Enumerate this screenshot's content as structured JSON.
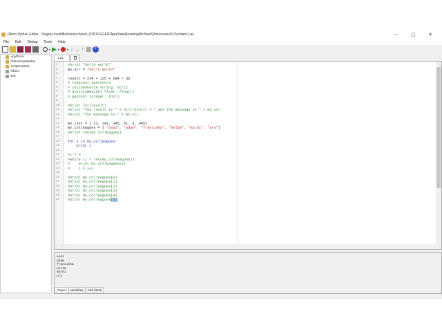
{
  "window": {
    "title": "Rhino Python Editor - \\\\tugras.local\\file\\home\\cherie\\_PROFILE\\FR\\AppData\\Roaming\\McNeel\\Rhinoceros\\6.0\\scripts\\1.py",
    "minimize": "–",
    "maximize": "▢",
    "close": "✕"
  },
  "menu": [
    "File",
    "Edit",
    "Debug",
    "Tools",
    "Help"
  ],
  "sidebar": [
    "<python>",
    "rhinoscriptsyntax",
    "scriptcontext",
    "Rhino",
    "Eto"
  ],
  "tabs": [
    {
      "label": "1.py"
    },
    {
      "label": ""
    }
  ],
  "code": [
    {
      "n": "1",
      "t": "#print \"hello world\"",
      "k": "cm"
    },
    {
      "n": "2",
      "t": "my_str = ",
      "s": "\"hello world\""
    },
    {
      "n": "3",
      "t": ""
    },
    {
      "n": "4",
      "t": "result = 234 + 125 + 284 / 36"
    },
    {
      "n": "5",
      "t": "# typecast operators",
      "k": "cm"
    },
    {
      "n": "6",
      "t": "# zeichenkette string: str()",
      "k": "cm"
    },
    {
      "n": "7",
      "t": "# gleitkommazahl float: float()",
      "k": "cm"
    },
    {
      "n": "8",
      "t": "# ganzahl integer: int()",
      "k": "cm"
    },
    {
      "n": "9",
      "t": ""
    },
    {
      "n": "10",
      "t": "#print int(result)",
      "k": "cm"
    },
    {
      "n": "11",
      "t": "#print \"the result is \" + str(result) + \" and the message is \" + my_str",
      "k": "cm"
    },
    {
      "n": "12",
      "t": "#print \"the message is \" + my_str",
      "k": "cm"
    },
    {
      "n": "13",
      "t": ""
    },
    {
      "n": "14",
      "t": "my_list = [ 12, 141, 345, 51, 3, 945]"
    },
    {
      "n": "15",
      "t": "my_colleagues = [ ",
      "s": "\"andi\", \"adam\", \"franziska\", \"selim\", \"michi\", \"urs\"",
      "e": "]"
    },
    {
      "n": "16",
      "t": "#print len(my_colleagues)",
      "k": "cm"
    },
    {
      "n": "17",
      "t": ""
    },
    {
      "n": "18",
      "t": "for x in my_colleagues:",
      "k": "kw"
    },
    {
      "n": "19",
      "t": "    print x",
      "k": "kw"
    },
    {
      "n": "20",
      "t": ""
    },
    {
      "n": "21",
      "t": "#i = 0",
      "k": "cm"
    },
    {
      "n": "22",
      "t": "#while (i < len(my_colleagues)):",
      "k": "cm"
    },
    {
      "n": "23",
      "t": "#    print my_colleagues[i]",
      "k": "cm"
    },
    {
      "n": "24",
      "t": "#    i = i+1",
      "k": "cm"
    },
    {
      "n": "25",
      "t": ""
    },
    {
      "n": "26",
      "t": "#print my_colleagues[0]",
      "k": "cm"
    },
    {
      "n": "27",
      "t": "#print my_colleagues[1]",
      "k": "cm"
    },
    {
      "n": "28",
      "t": "#print my_colleagues[2]",
      "k": "cm"
    },
    {
      "n": "29",
      "t": "#print my_colleagues[3]",
      "k": "cm"
    },
    {
      "n": "30",
      "t": "#print my_colleagues[4]",
      "k": "cm"
    },
    {
      "n": "31",
      "t": "#print my_colleagues",
      "k": "cm",
      "sel": "[5]"
    }
  ],
  "output": "andi\nadam\nfranziska\nselim\nmichi\nurs",
  "output_tabs": [
    "Output",
    "Variables",
    "Call Stack"
  ]
}
